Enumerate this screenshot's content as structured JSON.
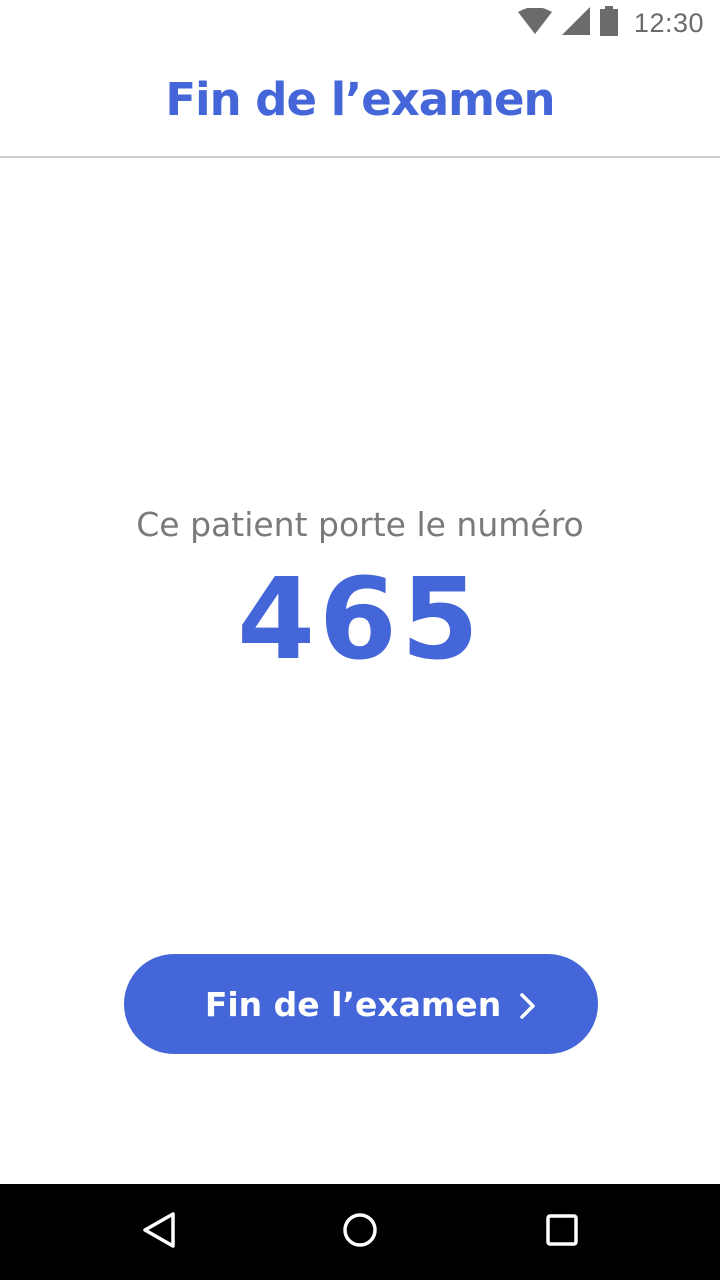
{
  "status_bar": {
    "time": "12:30",
    "icons": [
      "wifi-icon",
      "signal-icon",
      "battery-icon"
    ]
  },
  "header": {
    "title": "Fin de l’examen"
  },
  "main": {
    "patient_label": "Ce patient porte le numéro",
    "patient_number": "465"
  },
  "primary_action": {
    "label": "Fin de l’examen",
    "icon": "chevron-right-icon"
  },
  "nav_bar": {
    "buttons": [
      "back-icon",
      "home-icon",
      "recents-icon"
    ]
  },
  "colors": {
    "accent": "#4466d8",
    "label_gray": "#7a7a7a",
    "divider": "#d2d2d2",
    "nav_background": "#000000"
  }
}
